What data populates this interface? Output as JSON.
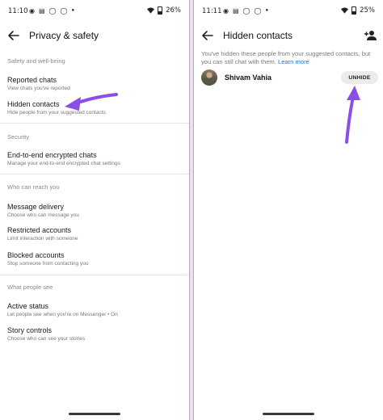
{
  "left": {
    "status": {
      "time": "11:10",
      "battery": "26%"
    },
    "title": "Privacy & safety",
    "sections": [
      {
        "header": "Safety and well-being",
        "items": [
          {
            "label": "Reported chats",
            "sub": "View chats you've reported"
          },
          {
            "label": "Hidden contacts",
            "sub": "Hide people from your suggested contacts"
          }
        ]
      },
      {
        "header": "Security",
        "items": [
          {
            "label": "End-to-end encrypted chats",
            "sub": "Manage your end-to-end encrypted chat settings"
          }
        ]
      },
      {
        "header": "Who can reach you",
        "items": [
          {
            "label": "Message delivery",
            "sub": "Choose who can message you"
          },
          {
            "label": "Restricted accounts",
            "sub": "Limit interaction with someone"
          },
          {
            "label": "Blocked accounts",
            "sub": "Stop someone from contacting you"
          }
        ]
      },
      {
        "header": "What people see",
        "items": [
          {
            "label": "Active status",
            "sub": "Let people see when you're on Messenger • On"
          },
          {
            "label": "Story controls",
            "sub": "Choose who can see your stories"
          }
        ]
      }
    ]
  },
  "right": {
    "status": {
      "time": "11:11",
      "battery": "25%"
    },
    "title": "Hidden contacts",
    "description": "You've hidden these people from your suggested contacts, but you can still chat with them.",
    "learn_more": "Learn more",
    "contact": {
      "name": "Shivam Vahia",
      "action": "UNHIDE"
    }
  },
  "colors": {
    "annotation_arrow": "#8b4fe6",
    "link": "#1a73d8"
  },
  "icons": [
    "back-arrow-icon",
    "add-person-icon",
    "wifi-icon",
    "battery-icon",
    "chat-notification-icon",
    "messenger-notification-icon"
  ]
}
